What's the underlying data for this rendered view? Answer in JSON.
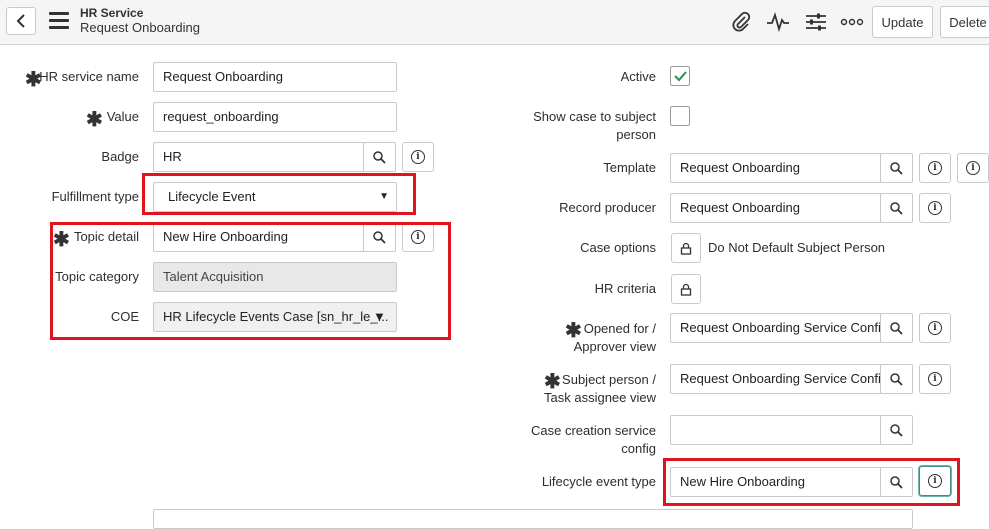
{
  "header": {
    "module": "HR Service",
    "record": "Request Onboarding",
    "update_label": "Update",
    "delete_label": "Delete"
  },
  "left": {
    "hr_service_name": {
      "label": "HR service name",
      "value": "Request Onboarding"
    },
    "value": {
      "label": "Value",
      "value": "request_onboarding"
    },
    "badge": {
      "label": "Badge",
      "value": "HR"
    },
    "fulfillment_type": {
      "label": "Fulfillment type",
      "value": "Lifecycle Event"
    },
    "topic_detail": {
      "label": "Topic detail",
      "value": "New Hire Onboarding"
    },
    "topic_category": {
      "label": "Topic category",
      "value": "Talent Acquisition"
    },
    "coe": {
      "label": "COE",
      "value": "HR Lifecycle Events Case [sn_hr_le_..."
    }
  },
  "right": {
    "active": {
      "label": "Active",
      "checked": true
    },
    "show_case": {
      "label_line1": "Show case to subject",
      "label_line2": "person",
      "checked": false
    },
    "template": {
      "label": "Template",
      "value": "Request Onboarding"
    },
    "record_producer": {
      "label": "Record producer",
      "value": "Request Onboarding"
    },
    "case_options": {
      "label": "Case options",
      "value": "Do Not Default Subject Person"
    },
    "hr_criteria": {
      "label": "HR criteria"
    },
    "opened_for": {
      "label_line1": "Opened for /",
      "label_line2": "Approver view",
      "value": "Request Onboarding Service Config"
    },
    "subject_person": {
      "label_line1": "Subject person /",
      "label_line2": "Task assignee view",
      "value": "Request Onboarding Service Config"
    },
    "case_creation": {
      "label_line1": "Case creation service",
      "label_line2": "config",
      "value": ""
    },
    "lifecycle_event_type": {
      "label": "Lifecycle event type",
      "value": "New Hire Onboarding"
    }
  },
  "colors": {
    "highlight": "#e0141e",
    "check": "#2e8b57",
    "header_bg": "#f5f5f5"
  },
  "icons": [
    "chevron-left-icon",
    "hamburger-icon",
    "paperclip-icon",
    "activity-icon",
    "sliders-icon",
    "more-icon",
    "search-icon",
    "info-icon",
    "lock-icon",
    "checkmark-icon",
    "dropdown-arrow-icon"
  ]
}
